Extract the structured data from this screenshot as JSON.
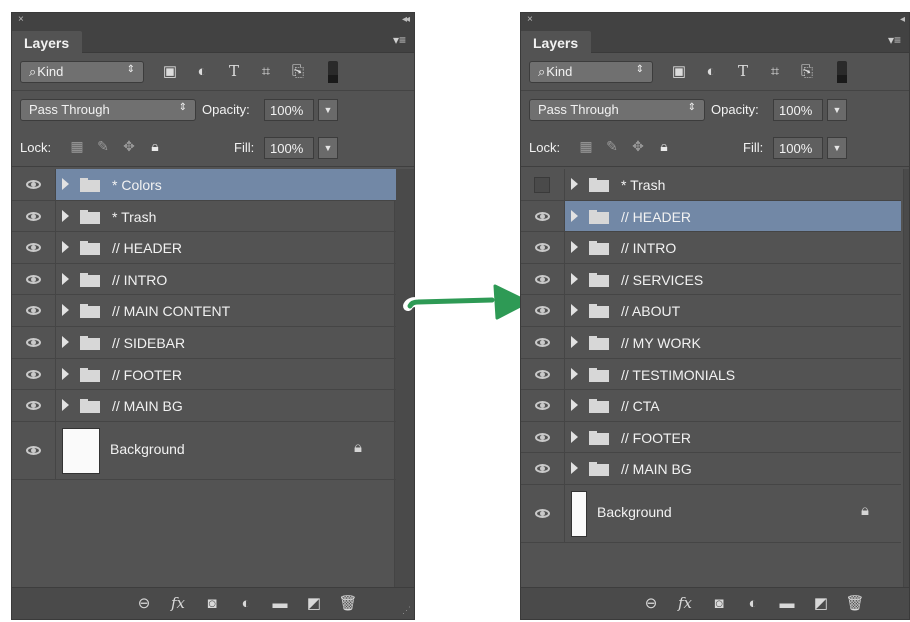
{
  "left_panel": {
    "close_glyph": "×",
    "collapse_glyph": "◂◂",
    "tab_label": "Layers",
    "menu_glyph": "▾≡",
    "kind_select": {
      "icon": "search-icon",
      "label": "Kind",
      "caret": "⇕"
    },
    "filter_icons": [
      "image-filter-icon",
      "adjustment-filter-icon",
      "type-filter-icon",
      "shape-filter-icon",
      "smart-object-filter-icon"
    ],
    "blend_mode": "Pass Through",
    "blend_caret": "⇕",
    "opacity_label": "Opacity:",
    "opacity_value": "100%",
    "lock_label": "Lock:",
    "fill_label": "Fill:",
    "fill_value": "100%",
    "layers": [
      {
        "name": "* Colors",
        "visible": true,
        "selected": true
      },
      {
        "name": "* Trash",
        "visible": true,
        "selected": false
      },
      {
        "name": "// HEADER",
        "visible": true,
        "selected": false
      },
      {
        "name": "// INTRO",
        "visible": true,
        "selected": false
      },
      {
        "name": "// MAIN CONTENT",
        "visible": true,
        "selected": false
      },
      {
        "name": "// SIDEBAR",
        "visible": true,
        "selected": false
      },
      {
        "name": "// FOOTER",
        "visible": true,
        "selected": false
      },
      {
        "name": "// MAIN BG",
        "visible": true,
        "selected": false
      }
    ],
    "background_layer": {
      "name": "Background",
      "locked": true
    },
    "bottom_icons": [
      "link-layers-icon",
      "fx-icon",
      "layer-mask-icon",
      "adjustment-layer-icon",
      "new-group-icon",
      "new-layer-icon",
      "delete-layer-icon"
    ]
  },
  "right_panel": {
    "close_glyph": "×",
    "collapse_glyph": "◂",
    "tab_label": "Layers",
    "menu_glyph": "▾≡",
    "kind_select": {
      "icon": "search-icon",
      "label": "Kind",
      "caret": "⇕"
    },
    "blend_mode": "Pass Through",
    "blend_caret": "⇕",
    "opacity_label": "Opacity:",
    "opacity_value": "100%",
    "lock_label": "Lock:",
    "fill_label": "Fill:",
    "fill_value": "100%",
    "layers": [
      {
        "name": "* Trash",
        "visible": false,
        "selected": false
      },
      {
        "name": "// HEADER",
        "visible": true,
        "selected": true
      },
      {
        "name": "// INTRO",
        "visible": true,
        "selected": false
      },
      {
        "name": "// SERVICES",
        "visible": true,
        "selected": false
      },
      {
        "name": "// ABOUT",
        "visible": true,
        "selected": false
      },
      {
        "name": "// MY WORK",
        "visible": true,
        "selected": false
      },
      {
        "name": "// TESTIMONIALS",
        "visible": true,
        "selected": false
      },
      {
        "name": "// CTA",
        "visible": true,
        "selected": false
      },
      {
        "name": "// FOOTER",
        "visible": true,
        "selected": false
      },
      {
        "name": "// MAIN BG",
        "visible": true,
        "selected": false
      }
    ],
    "background_layer": {
      "name": "Background",
      "locked": true
    }
  },
  "colors": {
    "panel_bg": "#535353",
    "selected_row": "#7288a6",
    "arrow_green": "#2e9a55"
  }
}
